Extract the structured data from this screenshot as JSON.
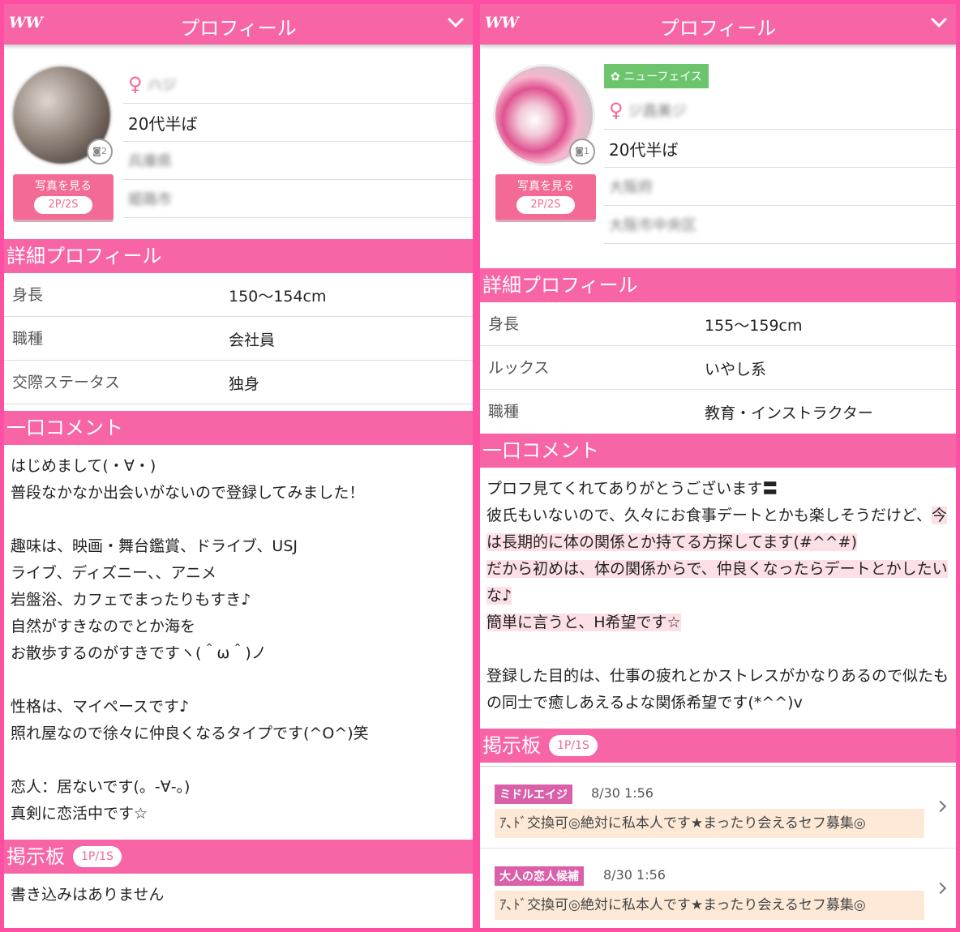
{
  "left": {
    "topbar": {
      "logo": "WW",
      "title": "プロフィール"
    },
    "photo_count": "2",
    "photo_button": {
      "label": "写真を見る",
      "points": "2P/2S"
    },
    "name_blurred": "ハジ",
    "age": "20代半ば",
    "area_blurred": "兵庫県",
    "city_blurred": "姫路市",
    "detail_title": "詳細プロフィール",
    "details": [
      {
        "key": "身長",
        "value": "150〜154cm"
      },
      {
        "key": "職種",
        "value": "会社員"
      },
      {
        "key": "交際ステータス",
        "value": "独身"
      }
    ],
    "comment_title": "一口コメント",
    "comment": "はじめまして(・∀・)\n普段なかなか出会いがないので登録してみました！\n\n趣味は、映画・舞台鑑賞、ドライブ、USJ\nライブ、ディズニー、、アニメ\n岩盤浴、カフェでまったりもすき♪\n自然がすきなのでとか海を\nお散歩するのがすきですヽ(＾ω＾)ノ\n\n性格は、マイペースです♪\n照れ屋なので徐々に仲良くなるタイプです(^O^)笑\n\n恋人：居ないです(。-∀-。)\n真剣に恋活中です☆",
    "board_title": "掲示板",
    "board_count": "1P/1S",
    "board_empty": "書き込みはありません"
  },
  "right": {
    "topbar": {
      "logo": "WW",
      "title": "プロフィール"
    },
    "photo_count": "1",
    "photo_button": {
      "label": "写真を見る",
      "points": "2P/2S"
    },
    "new_badge": "ニューフェイス",
    "name_blurred": "ジ昌美ジ",
    "age": "20代半ば",
    "area_blurred": "大阪府",
    "city_blurred": "大阪市中央区",
    "detail_title": "詳細プロフィール",
    "details": [
      {
        "key": "身長",
        "value": "155〜159cm"
      },
      {
        "key": "ルックス",
        "value": "いやし系"
      },
      {
        "key": "職種",
        "value": "教育・インストラクター"
      }
    ],
    "comment_title": "一口コメント",
    "comment": {
      "line1": "プロフ見てくれてありがとうございます〓",
      "line2a": "彼氏もいないので、久々にお食事デートとかも楽しそうだけど、",
      "line2b": "今は長期的に体の関係とか持てる方探してます(#^^#)",
      "line3": "だから初めは、体の関係からで、仲良くなったらデートとかしたいな♪",
      "line4": "簡単に言うと、H希望です☆",
      "line5": "登録した目的は、仕事の疲れとかストレスがかなりあるので似たもの同士で癒しあえるよな関係希望です(*^^)v"
    },
    "board_title": "掲示板",
    "board_count": "1P/1S",
    "board_posts": [
      {
        "tag": "ミドルエイジ",
        "date": "8/30 1:56",
        "message": "ｱ､ﾄﾞ交換可◎絶対に私本人です★まったり会えるセフ募集◎"
      },
      {
        "tag": "大人の恋人候補",
        "date": "8/30 1:56",
        "message": "ｱ､ﾄﾞ交換可◎絶対に私本人です★まったり会えるセフ募集◎"
      }
    ]
  },
  "colors": {
    "frame": "#ff4fa3",
    "header": "#f765a6",
    "button": "#f36b95",
    "new_badge": "#6cc56c",
    "board_tag": "#d960a9",
    "highlight": "#fde0e6",
    "board_msg_bg": "#fde9d6"
  }
}
